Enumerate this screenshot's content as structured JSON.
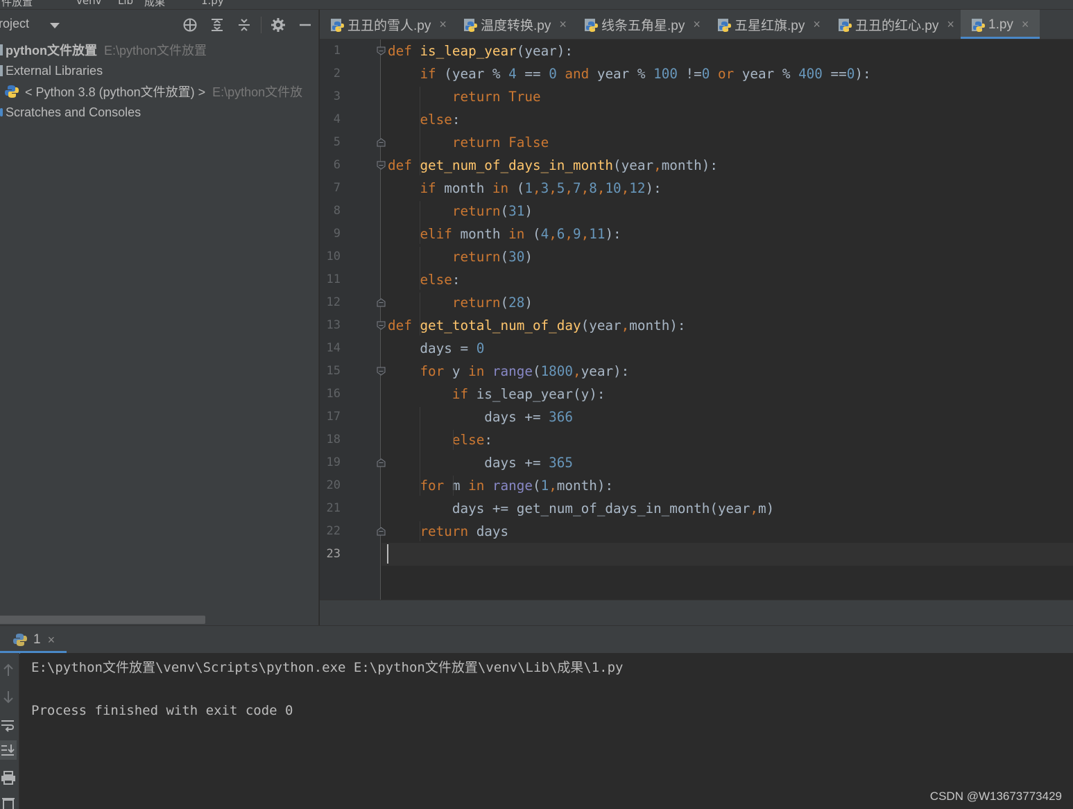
{
  "breadcrumb": {
    "segments": [
      "件放置",
      "venv",
      "Lib",
      "成果",
      "1.py"
    ]
  },
  "project_panel": {
    "title": "roject",
    "toolbar_icons": [
      "locate-icon",
      "expand-all-icon",
      "collapse-all-icon",
      "gear-icon",
      "minimize-icon"
    ],
    "tree": [
      {
        "label": "python文件放置",
        "path": "E:\\python文件放置"
      },
      {
        "label": "External Libraries",
        "path": ""
      },
      {
        "label": "< Python 3.8 (python文件放置) >",
        "path": "E:\\python文件放"
      },
      {
        "label": "Scratches and Consoles",
        "path": ""
      }
    ]
  },
  "tabs": [
    {
      "label": "丑丑的雪人.py",
      "active": false
    },
    {
      "label": "温度转换.py",
      "active": false
    },
    {
      "label": "线条五角星.py",
      "active": false
    },
    {
      "label": "五星红旗.py",
      "active": false
    },
    {
      "label": "丑丑的红心.py",
      "active": false
    },
    {
      "label": "1.py",
      "active": true
    }
  ],
  "tab_close_glyph": "×",
  "editor": {
    "current_line": 23,
    "lines": [
      [
        [
          "k",
          "def "
        ],
        [
          "f",
          "is_leap_year"
        ],
        [
          "p",
          "(year):"
        ]
      ],
      [
        [
          "p",
          "    "
        ],
        [
          "k",
          "if "
        ],
        [
          "p",
          "(year % "
        ],
        [
          "n",
          "4"
        ],
        [
          "p",
          " == "
        ],
        [
          "n",
          "0"
        ],
        [
          "p",
          " "
        ],
        [
          "k",
          "and"
        ],
        [
          "p",
          " year % "
        ],
        [
          "n",
          "100"
        ],
        [
          "p",
          " !="
        ],
        [
          "n",
          "0"
        ],
        [
          "p",
          " "
        ],
        [
          "k",
          "or"
        ],
        [
          "p",
          " year % "
        ],
        [
          "n",
          "400"
        ],
        [
          "p",
          " =="
        ],
        [
          "n",
          "0"
        ],
        [
          "p",
          "):"
        ]
      ],
      [
        [
          "p",
          "        "
        ],
        [
          "k",
          "return True"
        ]
      ],
      [
        [
          "p",
          "    "
        ],
        [
          "k",
          "else"
        ],
        [
          "p",
          ":"
        ]
      ],
      [
        [
          "p",
          "        "
        ],
        [
          "k",
          "return False"
        ]
      ],
      [
        [
          "k",
          "def "
        ],
        [
          "f",
          "get_num_of_days_in_month"
        ],
        [
          "p",
          "(year"
        ],
        [
          "k",
          ","
        ],
        [
          "p",
          "month):"
        ]
      ],
      [
        [
          "p",
          "    "
        ],
        [
          "k",
          "if "
        ],
        [
          "p",
          "month "
        ],
        [
          "k",
          "in "
        ],
        [
          "p",
          "("
        ],
        [
          "n",
          "1"
        ],
        [
          "k",
          ","
        ],
        [
          "n",
          "3"
        ],
        [
          "k",
          ","
        ],
        [
          "n",
          "5"
        ],
        [
          "k",
          ","
        ],
        [
          "n",
          "7"
        ],
        [
          "k",
          ","
        ],
        [
          "n",
          "8"
        ],
        [
          "k",
          ","
        ],
        [
          "n",
          "10"
        ],
        [
          "k",
          ","
        ],
        [
          "n",
          "12"
        ],
        [
          "p",
          "):"
        ]
      ],
      [
        [
          "p",
          "        "
        ],
        [
          "k",
          "return"
        ],
        [
          "p",
          "("
        ],
        [
          "n",
          "31"
        ],
        [
          "p",
          ")"
        ]
      ],
      [
        [
          "p",
          "    "
        ],
        [
          "k",
          "elif "
        ],
        [
          "p",
          "month "
        ],
        [
          "k",
          "in "
        ],
        [
          "p",
          "("
        ],
        [
          "n",
          "4"
        ],
        [
          "k",
          ","
        ],
        [
          "n",
          "6"
        ],
        [
          "k",
          ","
        ],
        [
          "n",
          "9"
        ],
        [
          "k",
          ","
        ],
        [
          "n",
          "11"
        ],
        [
          "p",
          "):"
        ]
      ],
      [
        [
          "p",
          "        "
        ],
        [
          "k",
          "return"
        ],
        [
          "p",
          "("
        ],
        [
          "n",
          "30"
        ],
        [
          "p",
          ")"
        ]
      ],
      [
        [
          "p",
          "    "
        ],
        [
          "k",
          "else"
        ],
        [
          "p",
          ":"
        ]
      ],
      [
        [
          "p",
          "        "
        ],
        [
          "k",
          "return"
        ],
        [
          "p",
          "("
        ],
        [
          "n",
          "28"
        ],
        [
          "p",
          ")"
        ]
      ],
      [
        [
          "k",
          "def "
        ],
        [
          "f",
          "get_total_num_of_day"
        ],
        [
          "p",
          "(year"
        ],
        [
          "k",
          ","
        ],
        [
          "p",
          "month):"
        ]
      ],
      [
        [
          "p",
          "    days = "
        ],
        [
          "n",
          "0"
        ]
      ],
      [
        [
          "p",
          "    "
        ],
        [
          "k",
          "for "
        ],
        [
          "p",
          "y "
        ],
        [
          "k",
          "in "
        ],
        [
          "b",
          "range"
        ],
        [
          "p",
          "("
        ],
        [
          "n",
          "1800"
        ],
        [
          "k",
          ","
        ],
        [
          "p",
          "year):"
        ]
      ],
      [
        [
          "p",
          "        "
        ],
        [
          "k",
          "if "
        ],
        [
          "p",
          "is_leap_year(y):"
        ]
      ],
      [
        [
          "p",
          "            days += "
        ],
        [
          "n",
          "366"
        ]
      ],
      [
        [
          "p",
          "        "
        ],
        [
          "k",
          "else"
        ],
        [
          "p",
          ":"
        ]
      ],
      [
        [
          "p",
          "            days += "
        ],
        [
          "n",
          "365"
        ]
      ],
      [
        [
          "p",
          "    "
        ],
        [
          "k",
          "for "
        ],
        [
          "p",
          "m "
        ],
        [
          "k",
          "in "
        ],
        [
          "b",
          "range"
        ],
        [
          "p",
          "("
        ],
        [
          "n",
          "1"
        ],
        [
          "k",
          ","
        ],
        [
          "p",
          "month):"
        ]
      ],
      [
        [
          "p",
          "        days += get_num_of_days_in_month(year"
        ],
        [
          "k",
          ","
        ],
        [
          "p",
          "m)"
        ]
      ],
      [
        [
          "p",
          "    "
        ],
        [
          "k",
          "return "
        ],
        [
          "p",
          "days"
        ]
      ],
      []
    ]
  },
  "run_panel": {
    "tab_label": "1",
    "console": [
      "E:\\python文件放置\\venv\\Scripts\\python.exe E:\\python文件放置\\venv\\Lib\\成果\\1.py",
      "",
      "Process finished with exit code 0"
    ],
    "side_icons": [
      "up-arrow-icon",
      "down-arrow-icon",
      "soft-wrap-icon",
      "scroll-to-end-icon",
      "print-icon",
      "trash-icon"
    ]
  },
  "watermark": "CSDN @W13673773429",
  "colors": {
    "keyword": "#cc7832",
    "function": "#ffc66d",
    "number": "#6897bb",
    "builtin": "#8888c6",
    "text": "#a9b7c6",
    "accent": "#4a88c7"
  }
}
